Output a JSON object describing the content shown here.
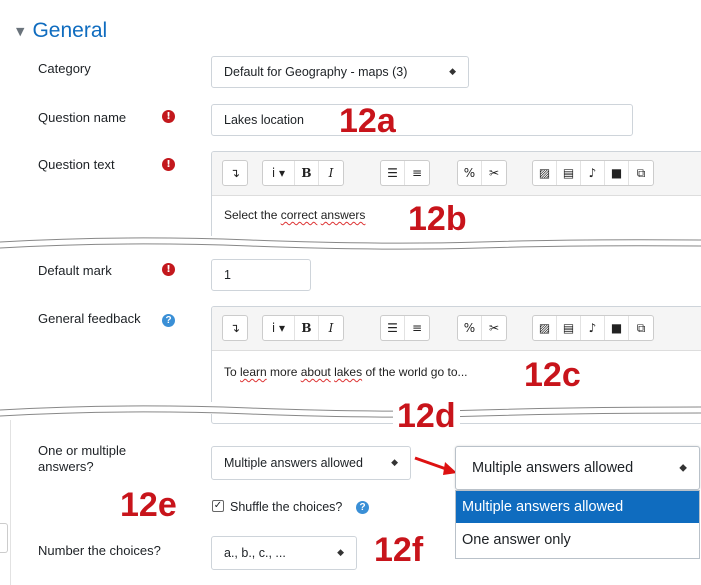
{
  "section": {
    "title": "General"
  },
  "category": {
    "label": "Category",
    "value": "Default for Geography - maps (3)"
  },
  "question_name": {
    "label": "Question name",
    "value": "Lakes location"
  },
  "question_text": {
    "label": "Question text",
    "content_parts": [
      "Select the ",
      "correct",
      " ",
      "answers"
    ]
  },
  "default_mark": {
    "label": "Default mark",
    "value": "1"
  },
  "general_feedback": {
    "label": "General feedback",
    "content_parts": [
      "To ",
      "learn",
      " more ",
      "about",
      " ",
      "lakes",
      " of the world go to..."
    ]
  },
  "multiple": {
    "label_line1": "One or multiple",
    "label_line2": "answers?",
    "value": "Multiple answers allowed"
  },
  "dropdown": {
    "selected": "Multiple answers allowed",
    "options": [
      "Multiple answers allowed",
      "One answer only"
    ]
  },
  "shuffle": {
    "label": "Shuffle the choices?",
    "checked": true
  },
  "numbering": {
    "label": "Number the choices?",
    "value": "a., b., c., ..."
  },
  "callouts": {
    "a": "12a",
    "b": "12b",
    "c": "12c",
    "d": "12d",
    "e": "12e",
    "f": "12f"
  },
  "colors": {
    "accent": "#0f6cbf",
    "callout": "#c8141b",
    "required": "#c3181d",
    "help": "#3a8fd6"
  },
  "icons": [
    "required-icon",
    "help-icon",
    "collapse-caret-icon",
    "select-arrow-icon",
    "arrow-icon"
  ]
}
